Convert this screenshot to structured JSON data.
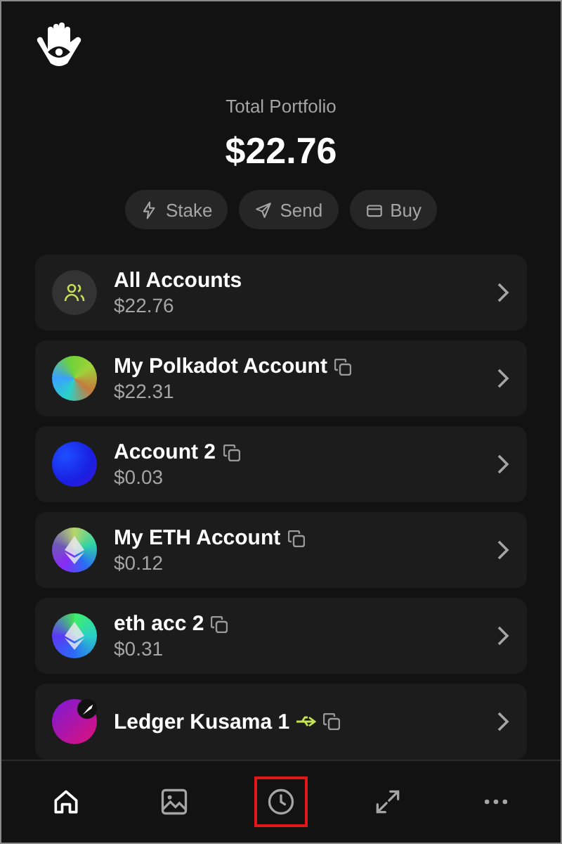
{
  "header": {
    "label": "Total Portfolio",
    "total": "$22.76"
  },
  "actions": [
    {
      "kind": "stake",
      "label": "Stake"
    },
    {
      "kind": "send",
      "label": "Send"
    },
    {
      "kind": "buy",
      "label": "Buy"
    }
  ],
  "accounts": [
    {
      "kind": "all",
      "name": "All Accounts",
      "balance": "$22.76",
      "copyable": false,
      "ledger": false
    },
    {
      "kind": "polkadot",
      "name": "My Polkadot Account",
      "balance": "$22.31",
      "copyable": true,
      "ledger": false
    },
    {
      "kind": "blue",
      "name": "Account 2",
      "balance": "$0.03",
      "copyable": true,
      "ledger": false
    },
    {
      "kind": "eth",
      "name": "My ETH Account",
      "balance": "$0.12",
      "copyable": true,
      "ledger": false
    },
    {
      "kind": "eth2",
      "name": "eth acc 2",
      "balance": "$0.31",
      "copyable": true,
      "ledger": false
    },
    {
      "kind": "kusama",
      "name": "Ledger Kusama 1",
      "copyable": true,
      "ledger": true
    }
  ],
  "nav": [
    {
      "kind": "home",
      "selected": true,
      "highlighted": false
    },
    {
      "kind": "gallery",
      "selected": false,
      "highlighted": false
    },
    {
      "kind": "history",
      "selected": false,
      "highlighted": true
    },
    {
      "kind": "expand",
      "selected": false,
      "highlighted": false
    },
    {
      "kind": "more",
      "selected": false,
      "highlighted": false
    }
  ]
}
